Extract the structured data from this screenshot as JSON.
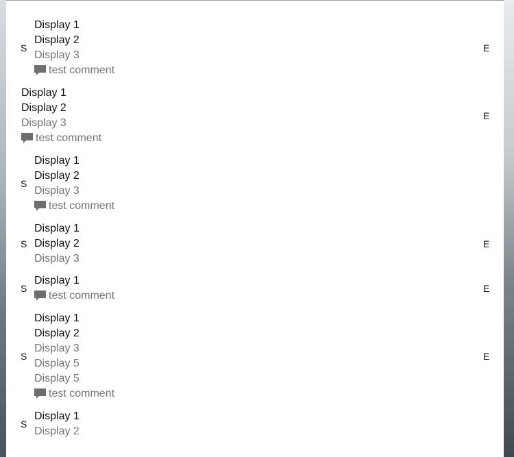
{
  "items": [
    {
      "start": "S",
      "end": "E",
      "lines": [
        {
          "text": "Display 1",
          "style": "primary"
        },
        {
          "text": "Display 2",
          "style": "primary"
        },
        {
          "text": "Display 3",
          "style": "secondary"
        }
      ],
      "comment": "test comment"
    },
    {
      "start": "",
      "end": "E",
      "lines": [
        {
          "text": "Display 1",
          "style": "primary"
        },
        {
          "text": "Display 2",
          "style": "primary"
        },
        {
          "text": "Display 3",
          "style": "secondary"
        }
      ],
      "comment": "test comment"
    },
    {
      "start": "S",
      "end": "",
      "lines": [
        {
          "text": "Display 1",
          "style": "primary"
        },
        {
          "text": "Display 2",
          "style": "primary"
        },
        {
          "text": "Display 3",
          "style": "secondary"
        }
      ],
      "comment": "test comment"
    },
    {
      "start": "S",
      "end": "E",
      "lines": [
        {
          "text": "Display 1",
          "style": "primary"
        },
        {
          "text": "Display 2",
          "style": "primary"
        },
        {
          "text": "Display 3",
          "style": "secondary"
        }
      ],
      "comment": ""
    },
    {
      "start": "S",
      "end": "E",
      "lines": [
        {
          "text": "Display 1",
          "style": "primary"
        }
      ],
      "comment": "test comment"
    },
    {
      "start": "S",
      "end": "E",
      "lines": [
        {
          "text": "Display 1",
          "style": "primary"
        },
        {
          "text": "Display 2",
          "style": "primary"
        },
        {
          "text": "Display 3",
          "style": "secondary"
        },
        {
          "text": "Display 5",
          "style": "secondary"
        },
        {
          "text": "Display 5",
          "style": "secondary"
        }
      ],
      "comment": "test comment"
    },
    {
      "start": "S",
      "end": "",
      "lines": [
        {
          "text": "Display 1",
          "style": "primary"
        },
        {
          "text": "Display 2",
          "style": "secondary"
        }
      ],
      "comment": ""
    }
  ],
  "colors": {
    "primary_text": "#111111",
    "secondary_text": "#757575",
    "comment_icon": "#757575"
  },
  "icons": {
    "comment": "comment-icon"
  }
}
